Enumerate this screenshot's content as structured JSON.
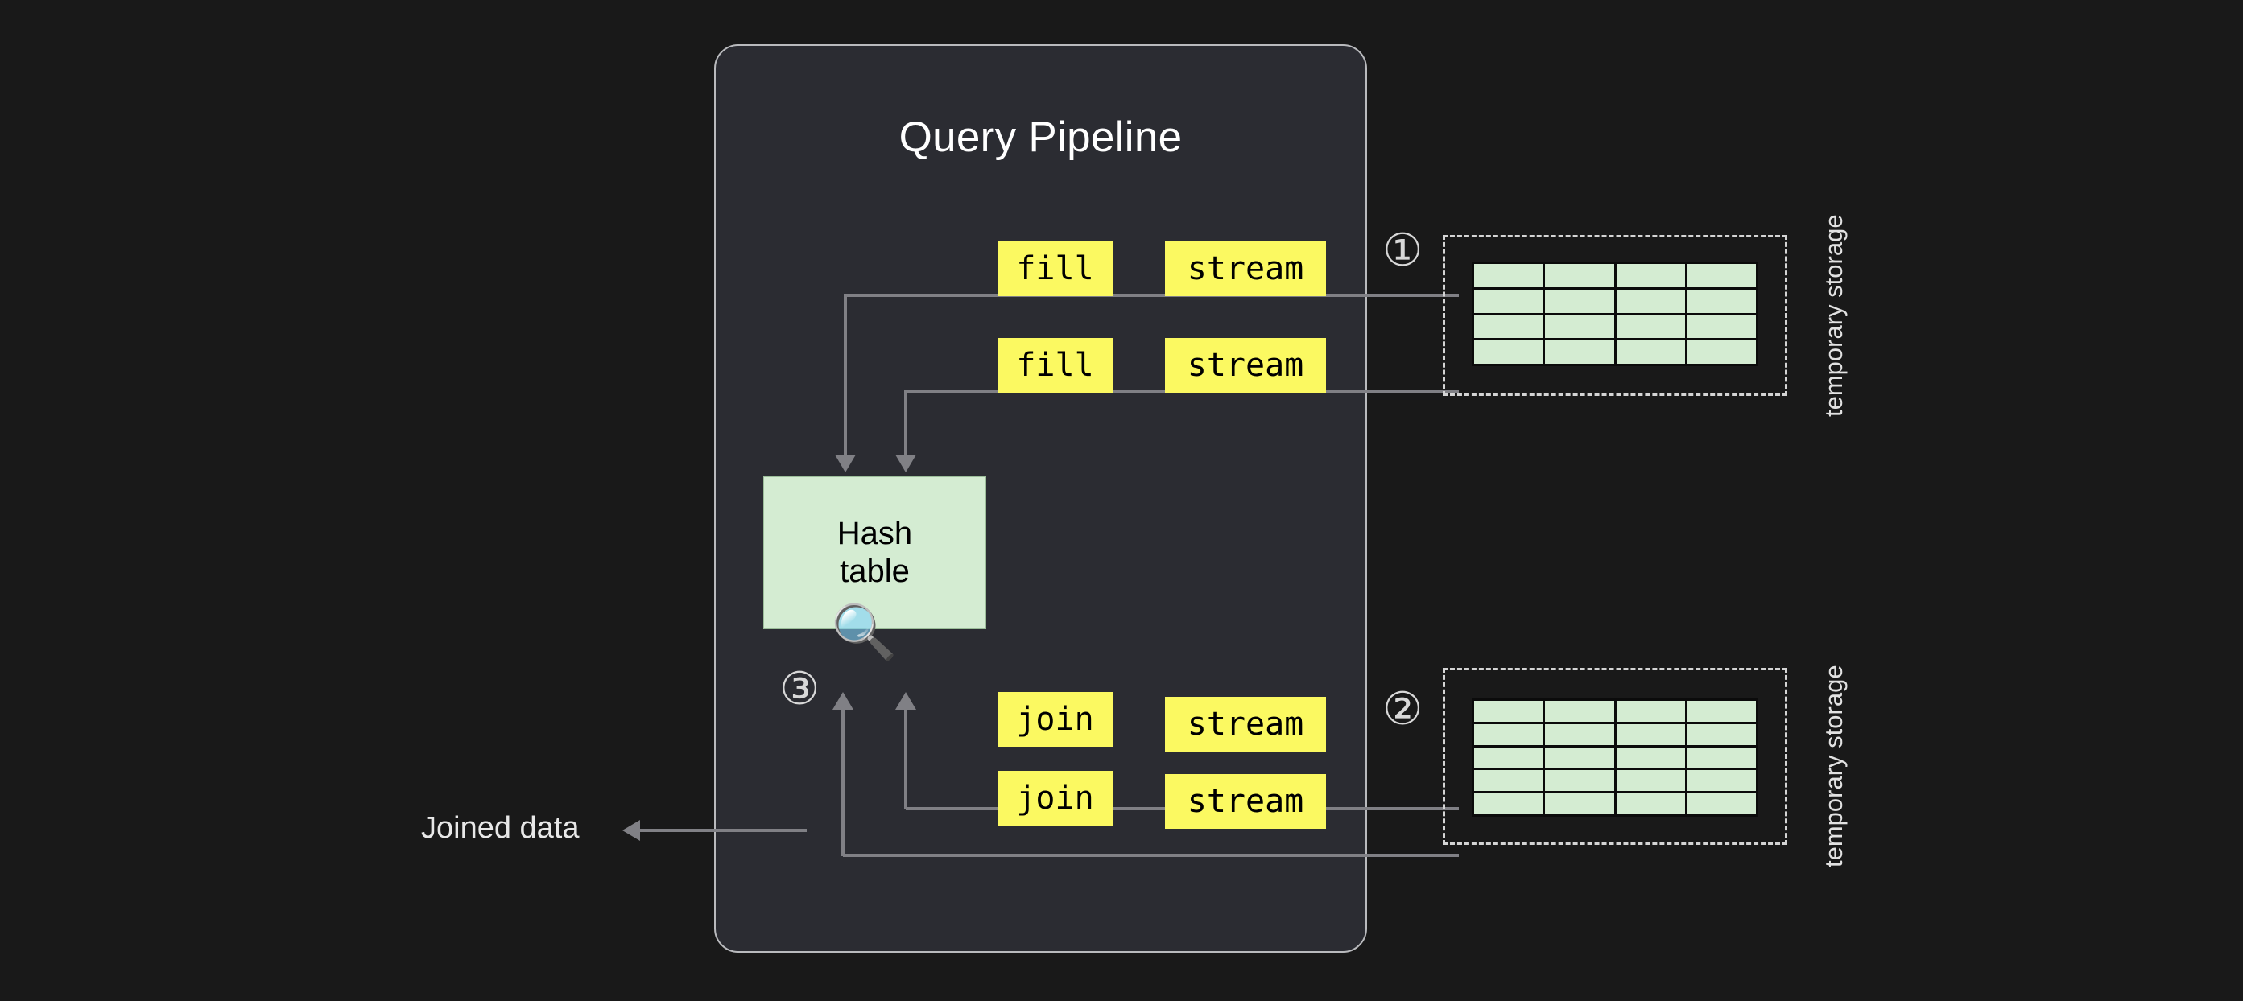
{
  "diagram": {
    "background_color": "#191919",
    "panel": {
      "title": "Query Pipeline",
      "fill_color": "#2b2c32",
      "border_color": "#b9babd"
    },
    "hash_table": {
      "line1": "Hash",
      "line2": "table",
      "fill_color": "#d4ecd2",
      "magnifier_icon": "🔍"
    },
    "operators": [
      {
        "label": "fill",
        "name": "fill-op-top"
      },
      {
        "label": "stream",
        "name": "stream-op-top"
      },
      {
        "label": "fill",
        "name": "fill-op-second"
      },
      {
        "label": "stream",
        "name": "stream-op-second"
      },
      {
        "label": "join",
        "name": "join-op-top"
      },
      {
        "label": "stream",
        "name": "stream-op-third"
      },
      {
        "label": "join",
        "name": "join-op-bottom"
      },
      {
        "label": "stream",
        "name": "stream-op-bottom"
      }
    ],
    "operator_color": "#fbf961",
    "steps": [
      {
        "marker": "①",
        "name": "step-1"
      },
      {
        "marker": "②",
        "name": "step-2"
      },
      {
        "marker": "③",
        "name": "step-3"
      }
    ],
    "storage": [
      {
        "label": "temporary storage",
        "rows": 4,
        "cols": 4,
        "name": "temporary-storage-top"
      },
      {
        "label": "temporary storage",
        "rows": 5,
        "cols": 4,
        "name": "temporary-storage-bottom"
      }
    ],
    "output": {
      "label": "Joined data"
    },
    "line_color": "#808085"
  }
}
